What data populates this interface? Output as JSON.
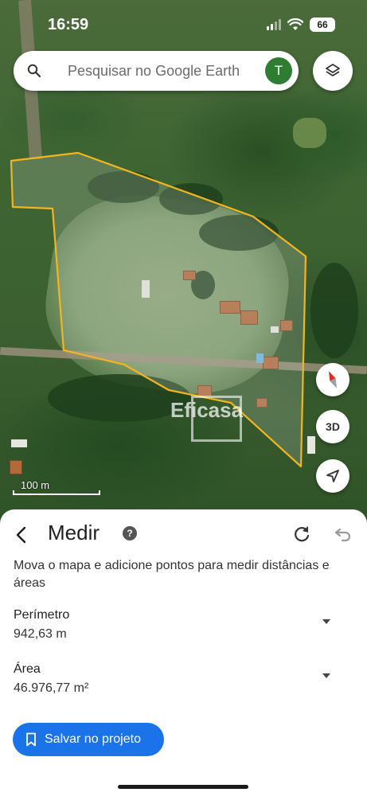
{
  "status_bar": {
    "time": "16:59",
    "battery": "66"
  },
  "search": {
    "placeholder": "Pesquisar no Google Earth",
    "avatar_initial": "T"
  },
  "map": {
    "scale_label": "100 m",
    "watermark": "Eficasa",
    "boundary_color": "#f2b51f",
    "three_d_label": "3D"
  },
  "sheet": {
    "title": "Medir",
    "instructions": "Mova o mapa e adicione pontos para medir distâncias e áreas",
    "perimeter": {
      "label": "Perímetro",
      "value": "942,63 m"
    },
    "area": {
      "label": "Área",
      "value": "46.976,77 m²"
    },
    "save_button": "Salvar no projeto"
  },
  "icons": [
    "search-icon",
    "layers-icon",
    "compass-icon",
    "3d-button",
    "my-location-icon",
    "back-arrow-icon",
    "help-icon",
    "redo-icon",
    "undo-icon",
    "chevron-down-icon",
    "bookmark-icon"
  ],
  "colors": {
    "accent": "#1a73e8",
    "avatar": "#2e7d32"
  }
}
